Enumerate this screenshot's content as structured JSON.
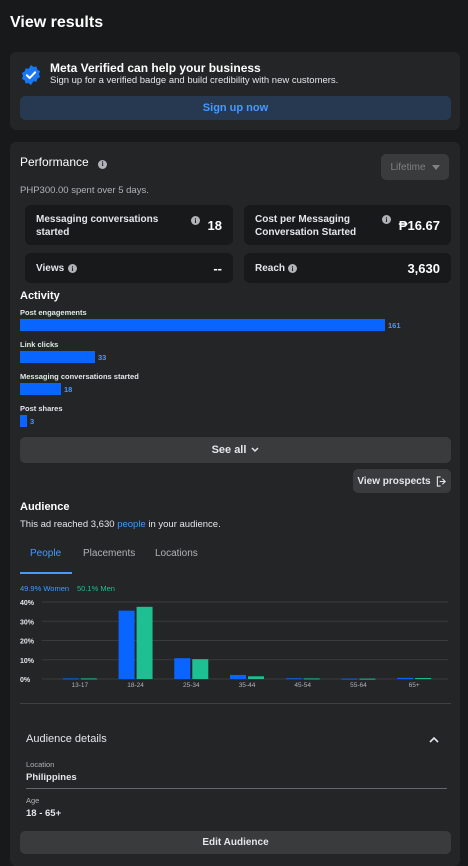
{
  "header": {
    "title": "View results"
  },
  "verified": {
    "heading": "Meta Verified can help your business",
    "subtext": "Sign up for a verified badge and build credibility with new customers.",
    "button_label": "Sign up now"
  },
  "performance": {
    "title": "Performance",
    "range_select": "Lifetime",
    "spent_text": "PHP300.00 spent over 5 days.",
    "metrics": [
      {
        "label": "Messaging conversations started",
        "value": "18"
      },
      {
        "label": "Cost per Messaging Conversation Started",
        "value": "₱16.67"
      },
      {
        "label": "Views",
        "value": "--"
      },
      {
        "label": "Reach",
        "value": "3,630"
      }
    ]
  },
  "activity": {
    "title": "Activity",
    "items": [
      {
        "label": "Post engagements",
        "value": 161
      },
      {
        "label": "Link clicks",
        "value": 33
      },
      {
        "label": "Messaging conversations started",
        "value": 18
      },
      {
        "label": "Post shares",
        "value": 3
      }
    ],
    "see_all_label": "See all",
    "view_prospects_label": "View prospects"
  },
  "audience": {
    "title": "Audience",
    "reach_prefix": "This ad reached 3,630 ",
    "reach_link": "people",
    "reach_suffix": " in your audience.",
    "tabs": [
      "People",
      "Placements",
      "Locations"
    ],
    "active_tab": "People",
    "legend_women": "49.9% Women",
    "legend_men": "50.1% Men",
    "colors": {
      "women": "#0866ff",
      "men": "#1fbf94"
    }
  },
  "chart_data": {
    "type": "bar",
    "categories": [
      "13-17",
      "18-24",
      "25-34",
      "35-44",
      "45-54",
      "55-64",
      "65+"
    ],
    "series": [
      {
        "name": "Women",
        "values": [
          0.3,
          35.5,
          10.8,
          2.1,
          0.4,
          0.2,
          0.6
        ]
      },
      {
        "name": "Men",
        "values": [
          0.3,
          37.5,
          10.3,
          1.4,
          0.3,
          0.2,
          0.5
        ]
      }
    ],
    "ylim": [
      0,
      40
    ],
    "yticks": [
      "0%",
      "10%",
      "20%",
      "30%",
      "40%"
    ],
    "grid": true
  },
  "audience_details": {
    "title": "Audience details",
    "location_label": "Location",
    "location_value": "Philippines",
    "age_label": "Age",
    "age_value": "18 - 65+",
    "edit_button_label": "Edit Audience"
  }
}
